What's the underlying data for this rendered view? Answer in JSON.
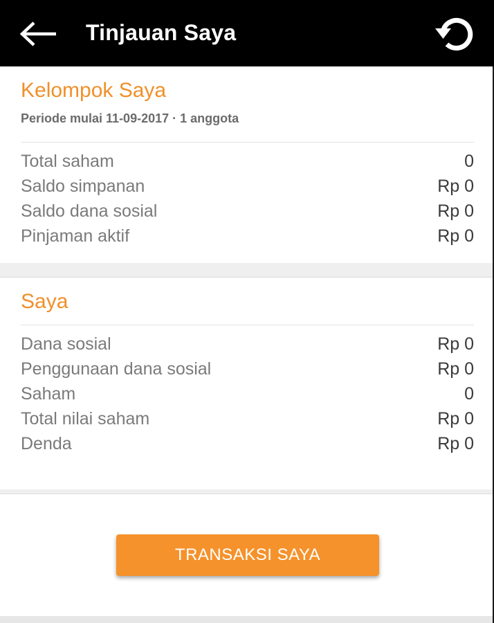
{
  "header": {
    "title": "Tinjauan Saya",
    "back_icon": "arrow-left-icon",
    "refresh_icon": "refresh-icon"
  },
  "group_section": {
    "title": "Kelompok Saya",
    "subtitle": "Periode mulai 11-09-2017 · 1 anggota",
    "rows": [
      {
        "label": "Total saham",
        "value": "0"
      },
      {
        "label": "Saldo simpanan",
        "value": "Rp 0"
      },
      {
        "label": "Saldo dana sosial",
        "value": "Rp 0"
      },
      {
        "label": "Pinjaman aktif",
        "value": "Rp 0"
      }
    ]
  },
  "me_section": {
    "title": "Saya",
    "rows": [
      {
        "label": "Dana sosial",
        "value": "Rp 0"
      },
      {
        "label": "Penggunaan dana sosial",
        "value": "Rp 0"
      },
      {
        "label": "Saham",
        "value": "0"
      },
      {
        "label": "Total nilai saham",
        "value": "Rp 0"
      },
      {
        "label": "Denda",
        "value": "Rp 0"
      }
    ]
  },
  "actions": {
    "transactions_label": "TRANSAKSI SAYA"
  },
  "colors": {
    "accent": "#f0902a",
    "button": "#f5922b",
    "header_bg": "#000000"
  }
}
